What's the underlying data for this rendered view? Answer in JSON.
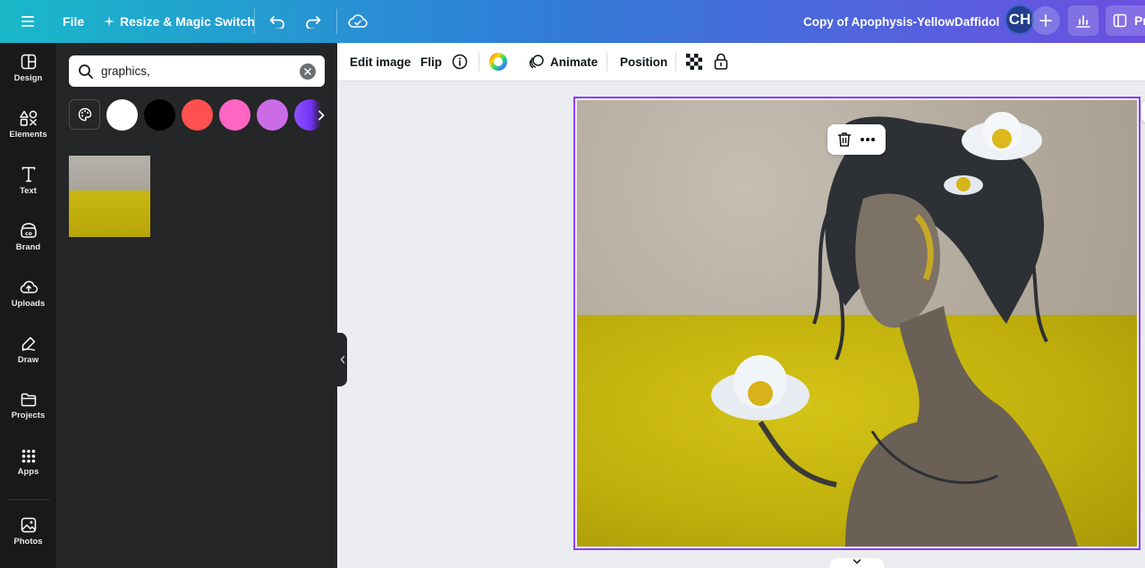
{
  "topbar": {
    "file_label": "File",
    "resize_label": "Resize & Magic Switch",
    "doc_title": "Copy of Apophysis-YellowDaffidol",
    "avatar_initials": "CH",
    "present_label": "Pr"
  },
  "rail": {
    "items": [
      {
        "label": "Design",
        "icon": "design-icon"
      },
      {
        "label": "Elements",
        "icon": "elements-icon"
      },
      {
        "label": "Text",
        "icon": "text-icon"
      },
      {
        "label": "Brand",
        "icon": "brand-icon"
      },
      {
        "label": "Uploads",
        "icon": "uploads-icon"
      },
      {
        "label": "Draw",
        "icon": "draw-icon"
      },
      {
        "label": "Projects",
        "icon": "projects-icon"
      },
      {
        "label": "Apps",
        "icon": "apps-icon"
      },
      {
        "label": "Photos",
        "icon": "photos-icon"
      }
    ]
  },
  "panel": {
    "search_value": "graphics,",
    "swatches": [
      "#ffffff",
      "#000000",
      "#ff5050",
      "#ff66c4",
      "#cb6ce6",
      "#8c52ff"
    ]
  },
  "context_toolbar": {
    "edit_image": "Edit image",
    "flip": "Flip",
    "animate": "Animate",
    "position": "Position"
  },
  "colors": {
    "accent": "#8b3dff",
    "rail_bg": "#18191b",
    "panel_bg": "#252627"
  }
}
